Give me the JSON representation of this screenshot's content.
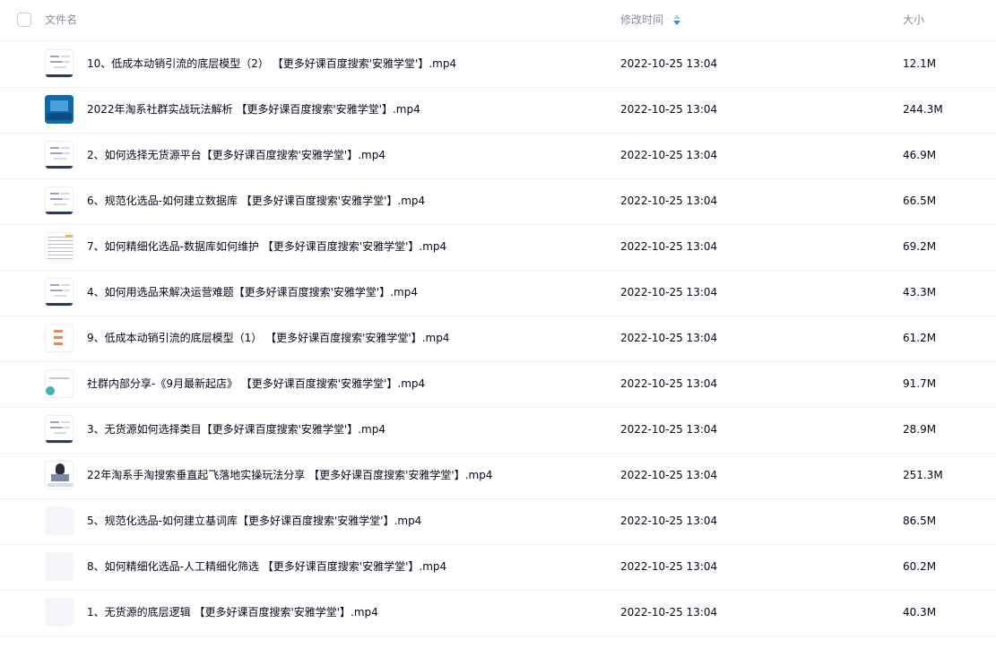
{
  "header": {
    "name_label": "文件名",
    "time_label": "修改时间",
    "size_label": "大小"
  },
  "colors": {
    "text": "#03081a",
    "header_text": "#878c9c",
    "divider": "#f1f2f4",
    "sort_active": "#2d8cf0"
  },
  "files": [
    {
      "name": "10、低成本动销引流的底层模型（2） 【更多好课百度搜索'安雅学堂'】.mp4",
      "modified": "2022-10-25 13:04",
      "size": "12.1M",
      "thumb": "doc"
    },
    {
      "name": "2022年淘系社群实战玩法解析 【更多好课百度搜索'安雅学堂'】.mp4",
      "modified": "2022-10-25 13:04",
      "size": "244.3M",
      "thumb": "blue"
    },
    {
      "name": "2、如何选择无货源平台【更多好课百度搜索'安雅学堂'】.mp4",
      "modified": "2022-10-25 13:04",
      "size": "46.9M",
      "thumb": "doc"
    },
    {
      "name": "6、规范化选品-如何建立数据库 【更多好课百度搜索'安雅学堂'】.mp4",
      "modified": "2022-10-25 13:04",
      "size": "66.5M",
      "thumb": "doc"
    },
    {
      "name": "7、如何精细化选品-数据库如何维护 【更多好课百度搜索'安雅学堂'】.mp4",
      "modified": "2022-10-25 13:04",
      "size": "69.2M",
      "thumb": "sheet"
    },
    {
      "name": "4、如何用选品来解决运营难题【更多好课百度搜索'安雅学堂'】.mp4",
      "modified": "2022-10-25 13:04",
      "size": "43.3M",
      "thumb": "doc"
    },
    {
      "name": "9、低成本动销引流的底层模型（1） 【更多好课百度搜索'安雅学堂'】.mp4",
      "modified": "2022-10-25 13:04",
      "size": "61.2M",
      "thumb": "orange"
    },
    {
      "name": "社群内部分享-《9月最新起店》 【更多好课百度搜索'安雅学堂'】.mp4",
      "modified": "2022-10-25 13:04",
      "size": "91.7M",
      "thumb": "teal"
    },
    {
      "name": "3、无货源如何选择类目【更多好课百度搜索'安雅学堂'】.mp4",
      "modified": "2022-10-25 13:04",
      "size": "28.9M",
      "thumb": "doc"
    },
    {
      "name": "22年淘系手淘搜索垂直起飞落地实操玩法分享 【更多好课百度搜索'安雅学堂'】.mp4",
      "modified": "2022-10-25 13:04",
      "size": "251.3M",
      "thumb": "person"
    },
    {
      "name": "5、规范化选品-如何建立基词库【更多好课百度搜索'安雅学堂'】.mp4",
      "modified": "2022-10-25 13:04",
      "size": "86.5M",
      "thumb": "blank"
    },
    {
      "name": "8、如何精细化选品-人工精细化筛选 【更多好课百度搜索'安雅学堂'】.mp4",
      "modified": "2022-10-25 13:04",
      "size": "60.2M",
      "thumb": "blank"
    },
    {
      "name": "1、无货源的底层逻辑 【更多好课百度搜索'安雅学堂'】.mp4",
      "modified": "2022-10-25 13:04",
      "size": "40.3M",
      "thumb": "blank"
    }
  ]
}
